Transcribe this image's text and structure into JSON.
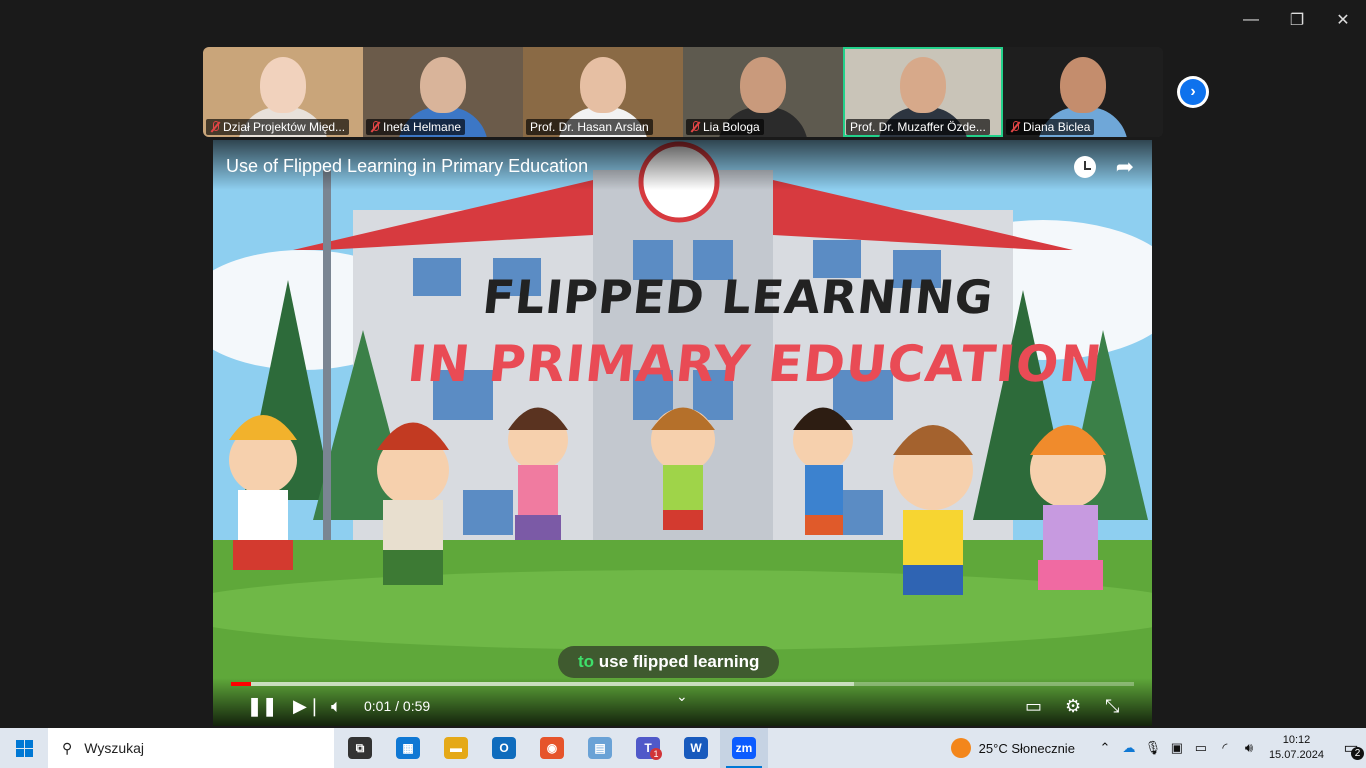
{
  "window": {
    "minimize_glyph": "—",
    "restore_glyph": "❐",
    "close_glyph": "✕"
  },
  "participants": [
    {
      "name": "Dział Projektów Międ...",
      "muted": true,
      "bg": "#c9a57a",
      "skin": "#f1d2bd",
      "shirt": "#e8e1da"
    },
    {
      "name": "Ineta Helmane",
      "muted": true,
      "bg": "#6b5b4a",
      "skin": "#d9b49a",
      "shirt": "#3c77c6"
    },
    {
      "name": "Prof. Dr. Hasan Arslan",
      "muted": false,
      "bg": "#8a6a45",
      "skin": "#e6bfa3",
      "shirt": "#f2f2f2"
    },
    {
      "name": "Lia Bologa",
      "muted": true,
      "bg": "#5e5a4f",
      "skin": "#c99a7c",
      "shirt": "#2b2b2b"
    },
    {
      "name": "Prof. Dr. Muzaffer Özde...",
      "muted": false,
      "bg": "#c9c4b8",
      "skin": "#d7a98a",
      "shirt": "#2d3540",
      "active": true
    },
    {
      "name": "Diana  Biclea",
      "muted": true,
      "bg": "#1e1e1e",
      "skin": "#c48d6d",
      "shirt": "#6fa7d8"
    }
  ],
  "next_icon": "chevron-right-icon",
  "video": {
    "title": "Use of Flipped Learning in Primary Education",
    "headline_line1": "FLIPPED LEARNING",
    "headline_line2": "IN PRIMARY EDUCATION",
    "caption_highlight": "to",
    "caption_rest": " use flipped learning",
    "time": "0:01 / 0:59",
    "played_fraction": 0.022,
    "buffered_fraction": 0.69
  },
  "taskbar": {
    "search_placeholder": "Wyszukaj",
    "apps": [
      {
        "name": "task-view",
        "glyph": "⧉",
        "color": "#333"
      },
      {
        "name": "microsoft-store",
        "glyph": "▦",
        "color": "#0f78d4"
      },
      {
        "name": "file-explorer",
        "glyph": "▬",
        "color": "#e5a918"
      },
      {
        "name": "outlook",
        "glyph": "O",
        "color": "#0f6cbd"
      },
      {
        "name": "firefox",
        "glyph": "◉",
        "color": "#e6542b"
      },
      {
        "name": "notepad",
        "glyph": "▤",
        "color": "#6aa2d6"
      },
      {
        "name": "teams",
        "glyph": "T",
        "color": "#5059c9",
        "badge": "1"
      },
      {
        "name": "word",
        "glyph": "W",
        "color": "#185abd"
      },
      {
        "name": "zoom",
        "glyph": "zm",
        "color": "#0b5cff",
        "active": true
      }
    ],
    "weather": "25°C  Słonecznie",
    "time": "10:12",
    "date": "15.07.2024",
    "notifications": "2"
  }
}
